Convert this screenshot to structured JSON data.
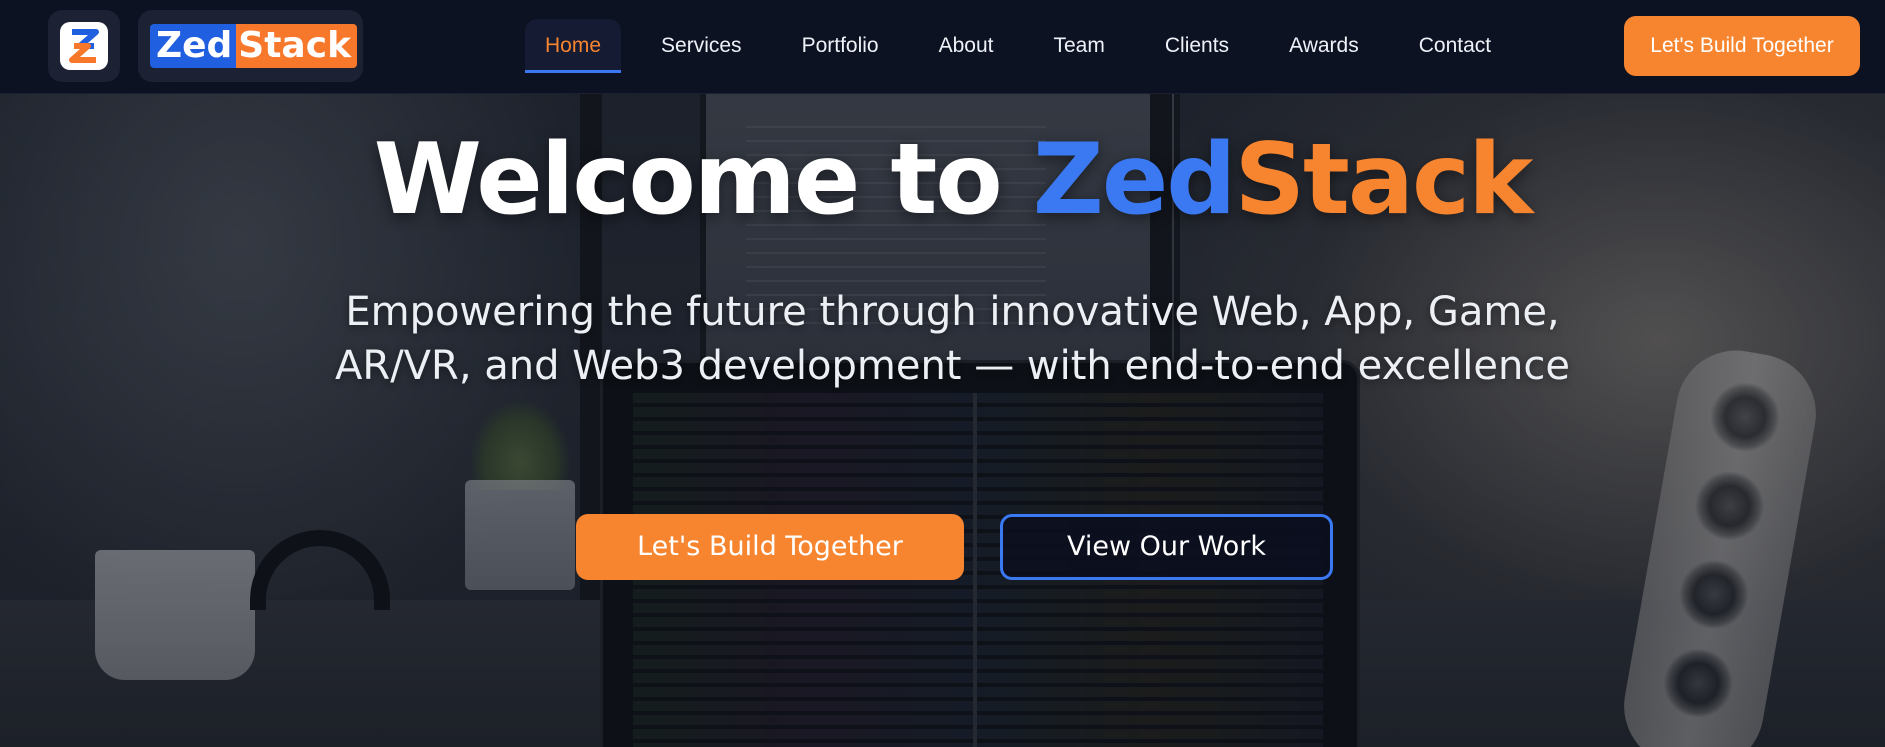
{
  "header": {
    "logo_icon": "zedstack-z-icon",
    "logo": {
      "part1": "Zed",
      "part2": "Stack"
    },
    "nav": [
      {
        "label": "Home",
        "active": true
      },
      {
        "label": "Services",
        "active": false
      },
      {
        "label": "Portfolio",
        "active": false
      },
      {
        "label": "About",
        "active": false
      },
      {
        "label": "Team",
        "active": false
      },
      {
        "label": "Clients",
        "active": false
      },
      {
        "label": "Awards",
        "active": false
      },
      {
        "label": "Contact",
        "active": false
      }
    ],
    "cta_label": "Let's Build Together"
  },
  "hero": {
    "title_prefix": "Welcome to ",
    "title_brand_part1": "Zed",
    "title_brand_part2": "Stack",
    "subtitle_line1": "Empowering the future through innovative Web, App, Game,",
    "subtitle_line2": "AR/VR, and Web3 development — with end-to-end excellence",
    "primary_button": "Let's Build Together",
    "secondary_button": "View Our Work"
  },
  "colors": {
    "accent_orange": "#f7852f",
    "accent_blue": "#3b79f2",
    "header_bg": "#0d1222"
  }
}
